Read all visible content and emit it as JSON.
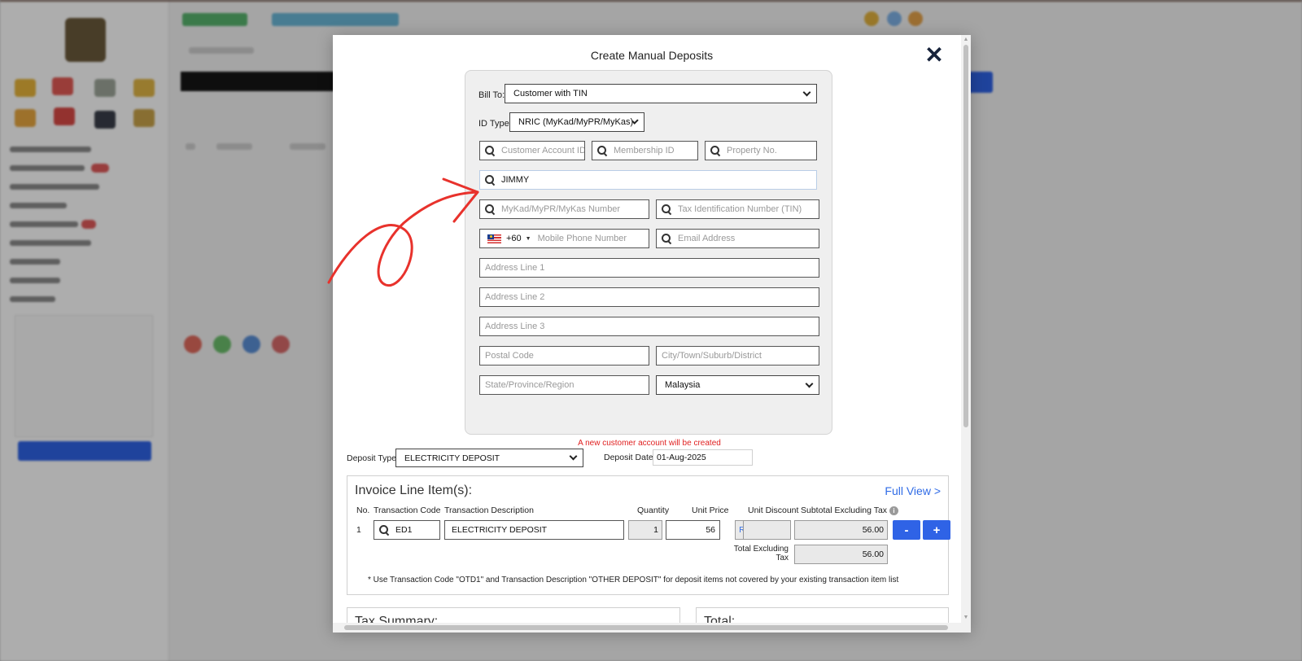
{
  "modal": {
    "title": "Create Manual Deposits",
    "close_label": "✕"
  },
  "customer": {
    "bill_to_label": "Bill To:",
    "bill_to_value": "Customer with TIN",
    "id_type_label": "ID Type:",
    "id_type_value": "NRIC (MyKad/MyPR/MyKas)",
    "customer_account_placeholder": "Customer Account ID",
    "membership_placeholder": "Membership ID",
    "property_placeholder": "Property No.",
    "name_value": "JIMMY",
    "mykad_placeholder": "MyKad/MyPR/MyKas Number",
    "tin_placeholder": "Tax Identification Number (TIN)",
    "phone_code": "+60",
    "phone_placeholder": "Mobile Phone Number",
    "email_placeholder": "Email Address",
    "address1_placeholder": "Address Line 1",
    "address2_placeholder": "Address Line 2",
    "address3_placeholder": "Address Line 3",
    "postal_placeholder": "Postal Code",
    "city_placeholder": "City/Town/Suburb/District",
    "state_placeholder": "State/Province/Region",
    "country_value": "Malaysia",
    "new_account_notice": "A new customer account will be created"
  },
  "deposit": {
    "type_label": "Deposit Type",
    "type_value": "ELECTRICITY DEPOSIT",
    "date_label": "Deposit Date",
    "date_value": "01-Aug-2025"
  },
  "invoice": {
    "title": "Invoice Line Item(s):",
    "full_view_label": "Full View >",
    "columns": {
      "no": "No.",
      "code": "Transaction Code",
      "description": "Transaction Description",
      "quantity": "Quantity",
      "unit_price": "Unit Price",
      "unit_discount": "Unit Discount",
      "subtotal": "Subtotal Excluding Tax"
    },
    "rows": [
      {
        "no": "1",
        "code": "ED1",
        "description": "ELECTRICITY DEPOSIT",
        "quantity": "1",
        "unit_price": "56",
        "currency": "RM",
        "unit_discount": "",
        "subtotal": "56.00"
      }
    ],
    "total_label": "Total Excluding Tax",
    "total_value": "56.00",
    "remove_label": "-",
    "add_label": "+",
    "note": "* Use Transaction Code \"OTD1\" and Transaction Description \"OTHER DEPOSIT\" for deposit items not covered by your existing transaction item list"
  },
  "summary": {
    "tax_title": "Tax Summary:",
    "total_title": "Total:"
  },
  "annotation": {
    "color": "#e8322c"
  },
  "icons": {
    "search": "search-icon",
    "close": "close-icon",
    "flag": "malaysia-flag-icon",
    "info": "info-icon"
  }
}
